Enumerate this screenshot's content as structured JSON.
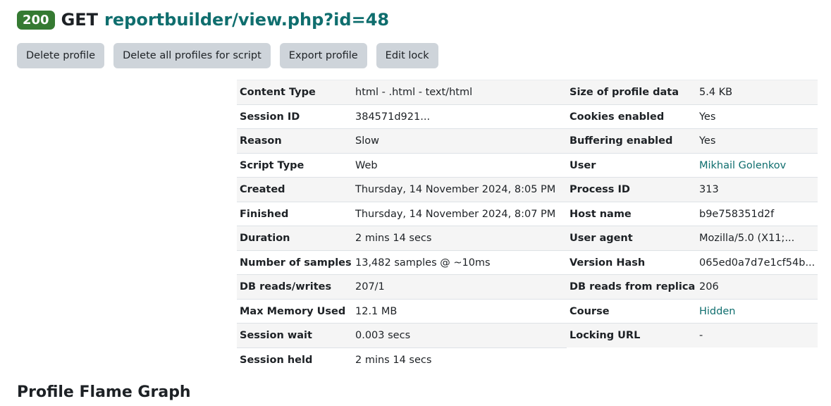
{
  "header": {
    "status": "200",
    "method": "GET",
    "url": "reportbuilder/view.php?id=48"
  },
  "toolbar": {
    "delete_profile": "Delete profile",
    "delete_all": "Delete all profiles for script",
    "export": "Export profile",
    "edit_lock": "Edit lock"
  },
  "details": {
    "rows": [
      {
        "k1": "Content Type",
        "v1": "html - .html - text/html",
        "k2": "Size of profile data",
        "v2": "5.4 KB"
      },
      {
        "k1": "Session ID",
        "v1": "384571d921...",
        "k2": "Cookies enabled",
        "v2": "Yes"
      },
      {
        "k1": "Reason",
        "v1": "Slow",
        "k2": "Buffering enabled",
        "v2": "Yes"
      },
      {
        "k1": "Script Type",
        "v1": "Web",
        "k2": "User",
        "v2": "Mikhail Golenkov"
      },
      {
        "k1": "Created",
        "v1": "Thursday, 14 November 2024, 8:05 PM",
        "k2": "Process ID",
        "v2": "313"
      },
      {
        "k1": "Finished",
        "v1": "Thursday, 14 November 2024, 8:07 PM",
        "k2": "Host name",
        "v2": "b9e758351d2f"
      },
      {
        "k1": "Duration",
        "v1": "2 mins 14 secs",
        "k2": "User agent",
        "v2": "Mozilla/5.0 (X11;..."
      },
      {
        "k1": "Number of samples",
        "v1": "13,482 samples @ ~10ms",
        "k2": "Version Hash",
        "v2": "065ed0a7d7e1cf54b..."
      },
      {
        "k1": "DB reads/writes",
        "v1": "207/1",
        "k2": "DB reads from replica",
        "v2": "206"
      },
      {
        "k1": "Max Memory Used",
        "v1": "12.1 MB",
        "k2": "Course",
        "v2": "Hidden"
      },
      {
        "k1": "Session wait",
        "v1": "0.003 secs",
        "k2": "Locking URL",
        "v2": "-"
      },
      {
        "k1": "Session held",
        "v1": "2 mins 14 secs"
      }
    ]
  },
  "section": {
    "title": "Profile Flame Graph"
  },
  "colors": {
    "badge": "#357a32",
    "link": "#0f6e6e",
    "button_bg": "#ced4da",
    "stripe": "#f5f5f5"
  }
}
